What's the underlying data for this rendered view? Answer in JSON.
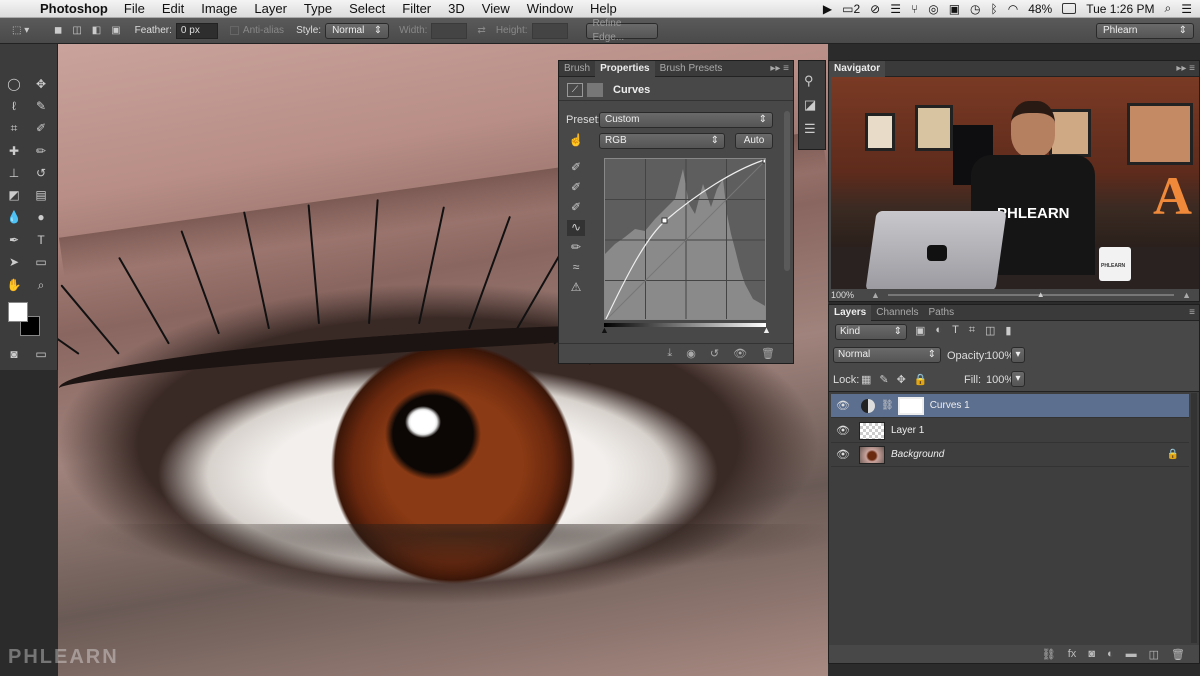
{
  "menubar": {
    "app": "Photoshop",
    "items": [
      "File",
      "Edit",
      "Image",
      "Layer",
      "Type",
      "Select",
      "Filter",
      "3D",
      "View",
      "Window",
      "Help"
    ],
    "status": {
      "display_number": "2",
      "battery": "48%",
      "clock": "Tue 1:26 PM"
    }
  },
  "options": {
    "feather_label": "Feather:",
    "feather_value": "0 px",
    "antialias_label": "Anti-alias",
    "style_label": "Style:",
    "style_value": "Normal",
    "width_label": "Width:",
    "height_label": "Height:",
    "refine_edge": "Refine Edge...",
    "workspace": "Phlearn"
  },
  "properties": {
    "tabs": [
      "Brush",
      "Properties",
      "Brush Presets"
    ],
    "title": "Curves",
    "preset_label": "Preset:",
    "preset_value": "Custom",
    "channel": "RGB",
    "auto_label": "Auto"
  },
  "navigator": {
    "tab": "Navigator",
    "zoom": "100%",
    "shirt_text": "PHLEARN",
    "mug_text": "PHLEARN",
    "sign_letter": "A"
  },
  "layers": {
    "tabs": [
      "Layers",
      "Channels",
      "Paths"
    ],
    "filter_value": "Kind",
    "blend_mode": "Normal",
    "opacity_label": "Opacity:",
    "opacity_value": "100%",
    "lock_label": "Lock:",
    "fill_label": "Fill:",
    "fill_value": "100%",
    "items": [
      {
        "name": "Curves 1",
        "selected": true
      },
      {
        "name": "Layer 1",
        "selected": false
      },
      {
        "name": "Background",
        "selected": false
      }
    ]
  },
  "watermark": "PHLEARN",
  "colors": {
    "selected_layer": "#5d6f8f",
    "panel_bg": "#484848",
    "accent_orange": "#f08a3a"
  }
}
